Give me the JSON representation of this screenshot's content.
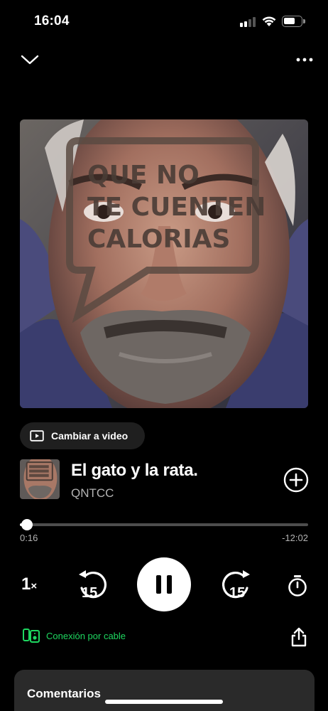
{
  "status_bar": {
    "time": "16:04"
  },
  "artwork": {
    "logo_lines": [
      "QUE NO",
      "TE CUENTEN",
      "CALORIAS"
    ]
  },
  "video_pill": {
    "label": "Cambiar a video"
  },
  "track": {
    "title": "El gato y la rata.",
    "artist": "QNTCC"
  },
  "progress": {
    "elapsed": "0:16",
    "remaining": "-12:02",
    "fraction": 0.025
  },
  "controls": {
    "speed": "1",
    "speed_suffix": "×",
    "skip_back_seconds": "15",
    "skip_forward_seconds": "15"
  },
  "connection": {
    "label": "Conexión por cable"
  },
  "comments": {
    "title": "Comentarios"
  },
  "colors": {
    "accent": "#1ed760",
    "background": "#000000"
  },
  "icons": [
    "chevron-down-icon",
    "more-icon",
    "video-icon",
    "add-circle-icon",
    "skip-back-icon",
    "pause-icon",
    "skip-forward-icon",
    "sleep-timer-icon",
    "device-icon",
    "share-icon"
  ]
}
